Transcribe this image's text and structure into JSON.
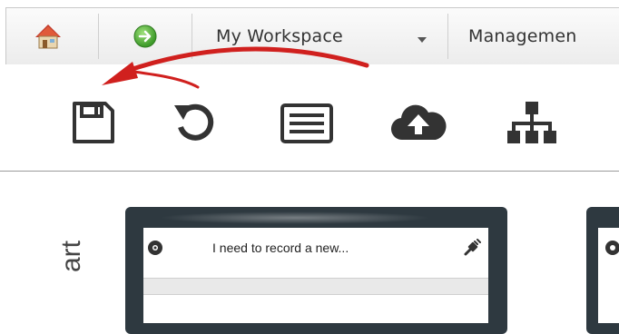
{
  "nav": {
    "items": [
      {
        "icon": "home-icon",
        "label": ""
      },
      {
        "icon": "forward-globe-icon",
        "label": ""
      },
      {
        "label": "My Workspace",
        "has_dropdown": true
      },
      {
        "label": "Managemen"
      }
    ]
  },
  "toolbar": {
    "tools": [
      "save-icon",
      "undo-icon",
      "list-icon",
      "cloud-upload-icon",
      "org-chart-icon"
    ]
  },
  "content": {
    "vertical_label": "art",
    "card": {
      "title": "I need to record a new..."
    }
  },
  "colors": {
    "annotation_arrow": "#d0201e",
    "card_frame": "#2e3940",
    "icon": "#333333"
  }
}
